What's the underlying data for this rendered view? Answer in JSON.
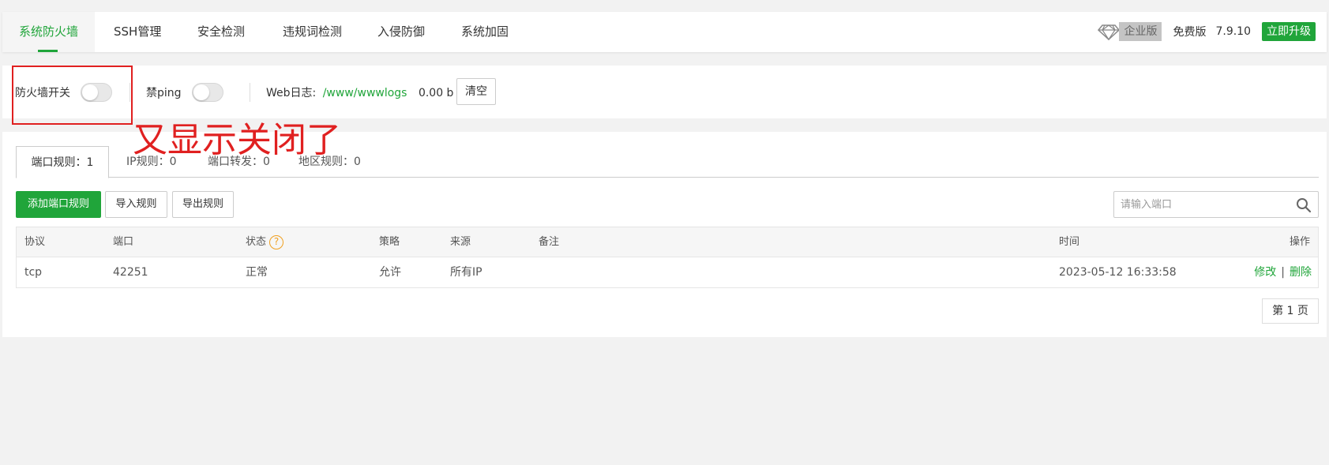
{
  "nav": {
    "tabs": [
      {
        "label": "系统防火墙"
      },
      {
        "label": "SSH管理"
      },
      {
        "label": "安全检测"
      },
      {
        "label": "违规词检测"
      },
      {
        "label": "入侵防御"
      },
      {
        "label": "系统加固"
      }
    ],
    "enterprise_label": "企业版",
    "free_label": "免费版",
    "version": "7.9.10",
    "upgrade_label": "立即升级"
  },
  "switches": {
    "firewall_label": "防火墙开关",
    "firewall_on": false,
    "ping_label": "禁ping",
    "ping_on": false,
    "weblog_label": "Web日志:",
    "weblog_path": "/www/wwwlogs",
    "weblog_size": "0.00 b",
    "clear_label": "清空"
  },
  "annotation": "又显示关闭了",
  "subtabs": [
    {
      "label": "端口规则：1"
    },
    {
      "label": "IP规则：0"
    },
    {
      "label": "端口转发：0"
    },
    {
      "label": "地区规则：0"
    }
  ],
  "actions": {
    "add_label": "添加端口规则",
    "import_label": "导入规则",
    "export_label": "导出规则",
    "search_placeholder": "请输入端口"
  },
  "table": {
    "headers": {
      "protocol": "协议",
      "port": "端口",
      "status": "状态",
      "policy": "策略",
      "source": "来源",
      "remark": "备注",
      "time": "时间",
      "ops": "操作"
    },
    "rows": [
      {
        "protocol": "tcp",
        "port": "42251",
        "status": "正常",
        "policy": "允许",
        "source": "所有IP",
        "remark": "",
        "time": "2023-05-12 16:33:58",
        "edit": "修改",
        "delete": "删除"
      }
    ]
  },
  "pager": {
    "label": "第 1 页"
  },
  "colors": {
    "accent": "#20a53a",
    "annotation": "#e02020",
    "help": "#f0a020"
  }
}
